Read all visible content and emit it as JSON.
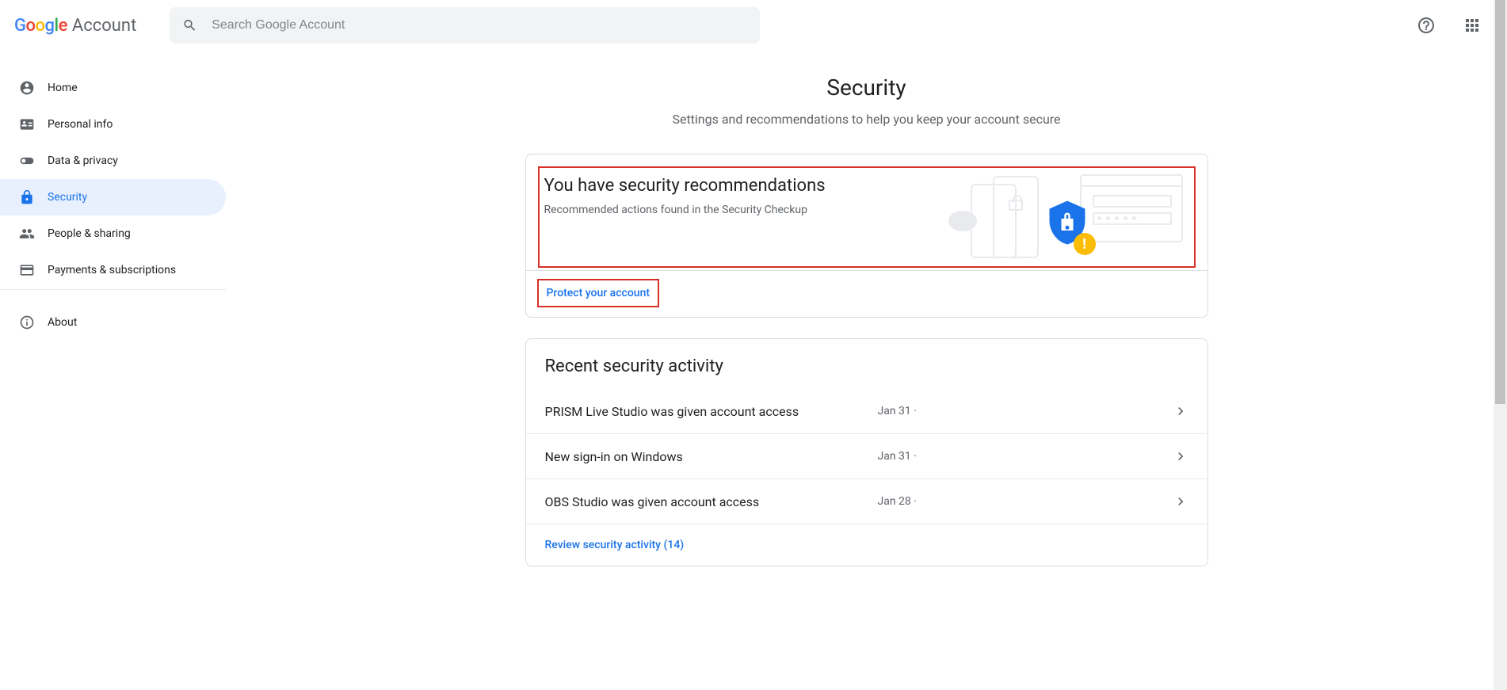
{
  "header": {
    "logo_letters": [
      "G",
      "o",
      "o",
      "g",
      "l",
      "e"
    ],
    "account_word": "Account",
    "search_placeholder": "Search Google Account"
  },
  "sidebar": {
    "items": [
      {
        "label": "Home"
      },
      {
        "label": "Personal info"
      },
      {
        "label": "Data & privacy"
      },
      {
        "label": "Security"
      },
      {
        "label": "People & sharing"
      },
      {
        "label": "Payments & subscriptions"
      }
    ],
    "about_label": "About"
  },
  "page": {
    "title": "Security",
    "subtitle": "Settings and recommendations to help you keep your account secure"
  },
  "recommendations": {
    "title": "You have security recommendations",
    "subtitle": "Recommended actions found in the Security Checkup",
    "protect_label": "Protect your account"
  },
  "activity": {
    "section_title": "Recent security activity",
    "rows": [
      {
        "label": "PRISM Live Studio was given account access",
        "date": "Jan 31 ·"
      },
      {
        "label": "New sign-in on Windows",
        "date": "Jan 31 ·"
      },
      {
        "label": "OBS Studio was given account access",
        "date": "Jan 28 ·"
      }
    ],
    "review_label": "Review security activity (14)"
  }
}
